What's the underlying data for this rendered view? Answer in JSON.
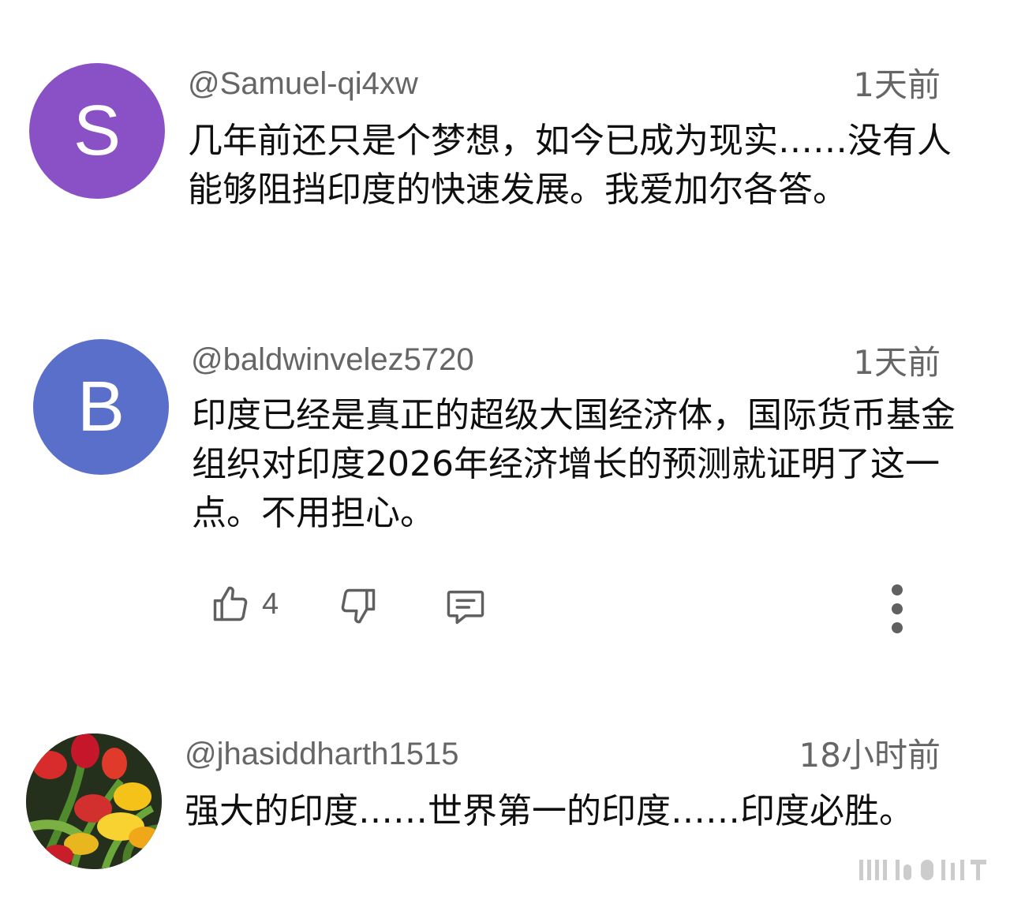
{
  "comments": [
    {
      "author": "@Samuel-qi4xw",
      "avatar_letter": "S",
      "avatar_color": "#8a50c6",
      "time": "1天前",
      "text": "几年前还只是个梦想，如今已成为现实……没有人能够阻挡印度的快速发展。我爱加尔各答。"
    },
    {
      "author": "@baldwinvelez5720",
      "avatar_letter": "B",
      "avatar_color": "#5a6fc9",
      "time": "1天前",
      "text": "印度已经是真正的超级大国经济体，国际货币基金组织对印度2026年经济增长的预测就证明了这一点。不用担心。",
      "likes": "4"
    },
    {
      "author": "@jhasiddharth1515",
      "avatar_image": "tulips",
      "time": "18小时前",
      "text": "强大的印度……世界第一的印度……印度必胜。"
    }
  ],
  "icons": {
    "like": "thumbs-up-icon",
    "dislike": "thumbs-down-icon",
    "reply": "comment-icon",
    "more": "more-vertical-icon"
  }
}
